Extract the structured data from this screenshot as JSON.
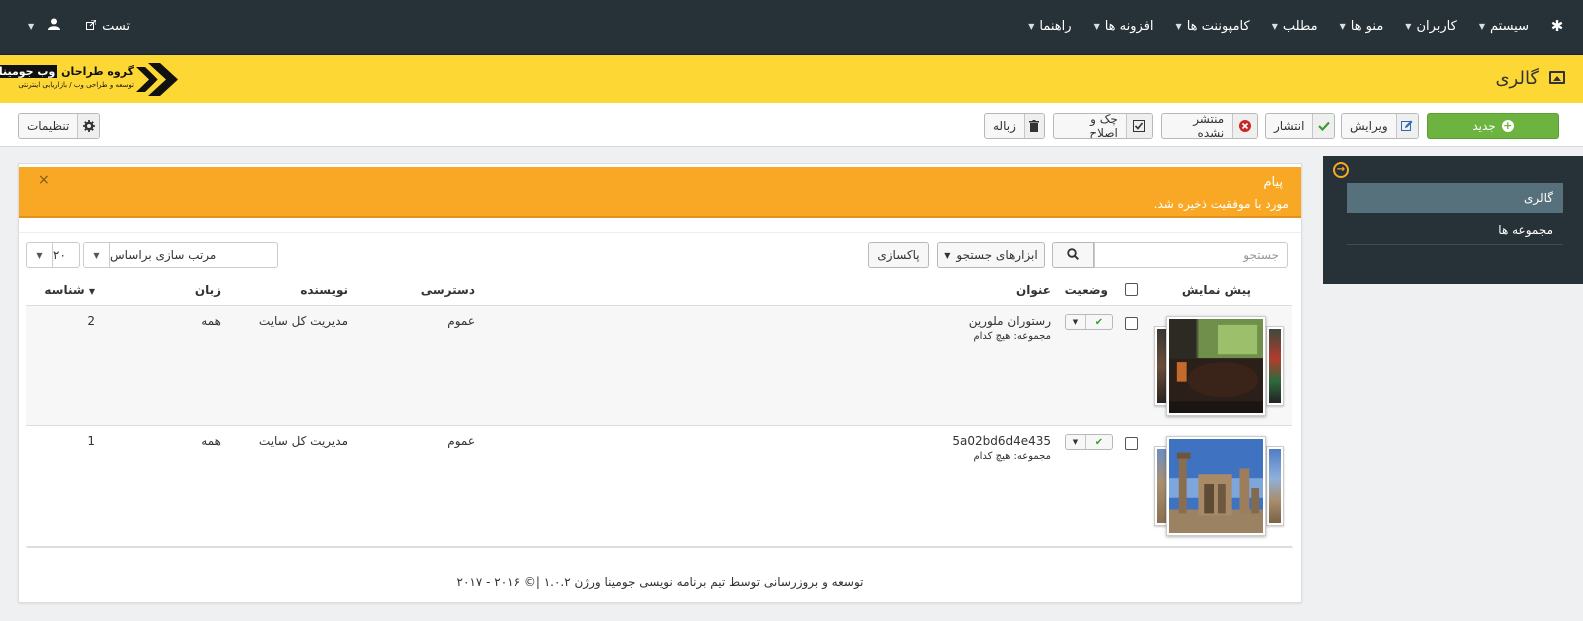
{
  "topnav": {
    "items": [
      {
        "label": "سیستم"
      },
      {
        "label": "کاربران"
      },
      {
        "label": "منو ها"
      },
      {
        "label": "مطلب"
      },
      {
        "label": "کامپوننت ها"
      },
      {
        "label": "افزونه ها"
      },
      {
        "label": "راهنما"
      }
    ],
    "site_link": "تست"
  },
  "header": {
    "title": "گالری",
    "brand_name_a": "گروه طراحان",
    "brand_name_b": "وب جومینا",
    "brand_sub": "توسعه و طراحی وب / بازاریابی اینترنتی",
    "accent": "#fdd835"
  },
  "toolbar": {
    "new_label": "جدید",
    "edit_label": "ویرایش",
    "publish_label": "انتشار",
    "unpublish_label": "منتشر نشده",
    "checkin_label": "چک و اصلاح",
    "trash_label": "زباله",
    "options_label": "تنظیمات"
  },
  "sidebar": {
    "items": [
      {
        "label": "گالری",
        "active": true
      },
      {
        "label": "مجموعه ها",
        "active": false
      }
    ]
  },
  "alert": {
    "heading": "پیام",
    "text": "مورد با موفقیت ذخیره شد.",
    "close": "×"
  },
  "filters": {
    "search_placeholder": "جستجو",
    "tools_label": "ابزارهای جستجو",
    "clear_label": "پاکسازی",
    "ordering_value": "مرتب سازی براساس",
    "limit_value": "۲۰"
  },
  "table": {
    "headers": {
      "preview": "پیش نمایش",
      "status": "وضعیت",
      "title": "عنوان",
      "access": "دسترسی",
      "author": "نویسنده",
      "language": "زبان",
      "id": "شناسه"
    },
    "rows": [
      {
        "title": "رستوران ملورین",
        "collection": "مجموعه: هیچ کدام",
        "access": "عموم",
        "author": "مدیریت کل سایت",
        "language": "همه",
        "id": "2",
        "published": true
      },
      {
        "title": "5a02bd6d4e435",
        "collection": "مجموعه: هیچ کدام",
        "access": "عموم",
        "author": "مدیریت کل سایت",
        "language": "همه",
        "id": "1",
        "published": true
      }
    ]
  },
  "footer": {
    "text": "توسعه و بروزرسانی توسط تیم برنامه نویسی جومینا ورژن ۱.۰.۲ |© ۲۰۱۶ - ۲۰۱۷"
  }
}
